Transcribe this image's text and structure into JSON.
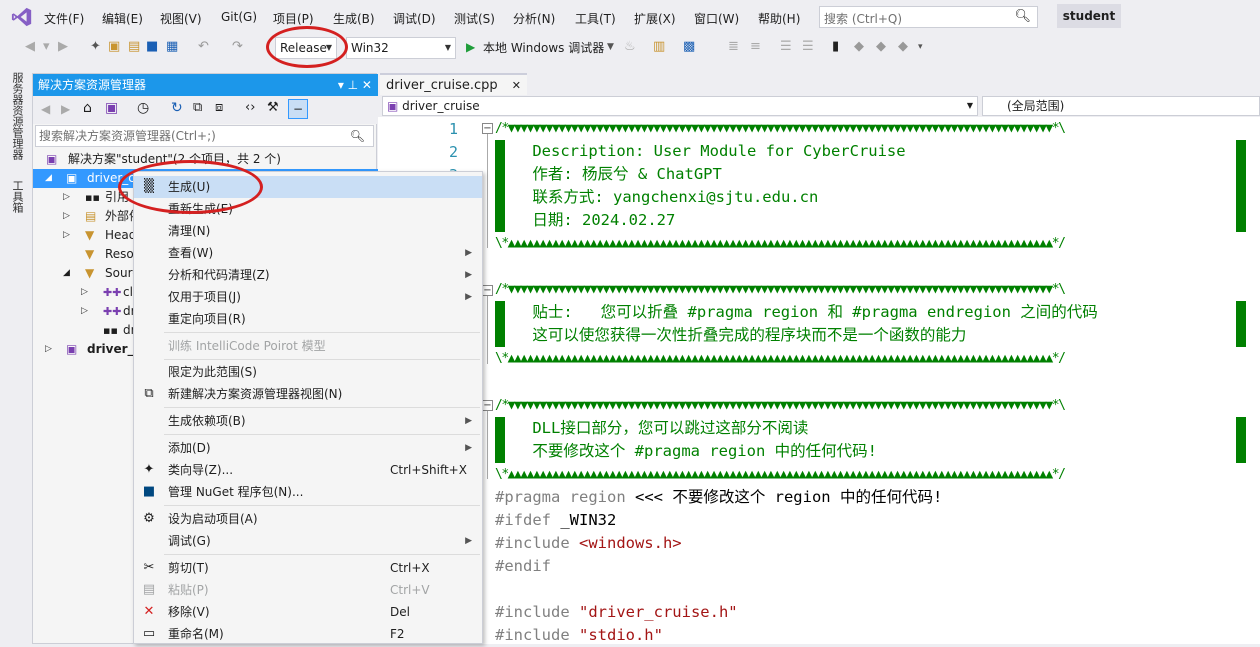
{
  "menubar": {
    "items": [
      "文件(F)",
      "编辑(E)",
      "视图(V)",
      "Git(G)",
      "项目(P)",
      "生成(B)",
      "调试(D)",
      "测试(S)",
      "分析(N)",
      "工具(T)",
      "扩展(X)",
      "窗口(W)",
      "帮助(H)"
    ],
    "search_placeholder": "搜索 (Ctrl+Q)",
    "profile": "student"
  },
  "toolbar": {
    "config": "Release",
    "platform": "Win32",
    "run_label": "本地 Windows 调试器"
  },
  "sidestrip": {
    "server_explorer": "服务器资源管理器",
    "toolbox": "工具箱"
  },
  "solution_explorer": {
    "title": "解决方案资源管理器",
    "title_controls": "▾ ⊥ ✕",
    "search_placeholder": "搜索解决方案资源管理器(Ctrl+;)",
    "tree": [
      "解决方案\"student\"(2 个项目，共 2 个)",
      "driver_c",
      "引用",
      "外部依",
      "Head",
      "Reso",
      "Sourc",
      "cla",
      "dr",
      "dr",
      "driver_c"
    ]
  },
  "editor": {
    "tab": "driver_cruise.cpp",
    "nav_left": "driver_cruise",
    "nav_right": "(全局范围)",
    "line_numbers": [
      "1",
      "2",
      "3"
    ],
    "lines": {
      "l1": "/*▼▼▼▼▼▼▼▼▼▼▼▼▼▼▼▼▼▼▼▼▼▼▼▼▼▼▼▼▼▼▼▼▼▼▼▼▼▼▼▼▼▼▼▼▼▼▼▼▼▼▼▼▼▼▼▼▼▼▼▼▼▼▼▼▼▼▼▼▼▼▼▼▼▼▼▼▼▼▼▼▼▼▼▼▼▼*\\",
      "l2": "    Description: User Module for CyberCruise",
      "l3": "    作者: 杨辰兮 & ChatGPT",
      "l4": "    联系方式: yangchenxi@sjtu.edu.cn",
      "l5": "    日期: 2024.02.27",
      "l6": "\\*▲▲▲▲▲▲▲▲▲▲▲▲▲▲▲▲▲▲▲▲▲▲▲▲▲▲▲▲▲▲▲▲▲▲▲▲▲▲▲▲▲▲▲▲▲▲▲▲▲▲▲▲▲▲▲▲▲▲▲▲▲▲▲▲▲▲▲▲▲▲▲▲▲▲▲▲▲▲▲▲▲▲▲▲▲▲*/",
      "l8": "/*▼▼▼▼▼▼▼▼▼▼▼▼▼▼▼▼▼▼▼▼▼▼▼▼▼▼▼▼▼▼▼▼▼▼▼▼▼▼▼▼▼▼▼▼▼▼▼▼▼▼▼▼▼▼▼▼▼▼▼▼▼▼▼▼▼▼▼▼▼▼▼▼▼▼▼▼▼▼▼▼▼▼▼▼▼▼*\\",
      "l9": "    贴士:   您可以折叠 #pragma region 和 #pragma endregion 之间的代码",
      "l10": "    这可以使您获得一次性折叠完成的程序块而不是一个函数的能力",
      "l11": "\\*▲▲▲▲▲▲▲▲▲▲▲▲▲▲▲▲▲▲▲▲▲▲▲▲▲▲▲▲▲▲▲▲▲▲▲▲▲▲▲▲▲▲▲▲▲▲▲▲▲▲▲▲▲▲▲▲▲▲▲▲▲▲▲▲▲▲▲▲▲▲▲▲▲▲▲▲▲▲▲▲▲▲▲▲▲▲*/",
      "l13": "/*▼▼▼▼▼▼▼▼▼▼▼▼▼▼▼▼▼▼▼▼▼▼▼▼▼▼▼▼▼▼▼▼▼▼▼▼▼▼▼▼▼▼▼▼▼▼▼▼▼▼▼▼▼▼▼▼▼▼▼▼▼▼▼▼▼▼▼▼▼▼▼▼▼▼▼▼▼▼▼▼▼▼▼▼▼▼*\\",
      "l14": "    DLL接口部分，您可以跳过这部分不阅读",
      "l15": "    不要修改这个 #pragma region 中的任何代码!",
      "l16": "\\*▲▲▲▲▲▲▲▲▲▲▲▲▲▲▲▲▲▲▲▲▲▲▲▲▲▲▲▲▲▲▲▲▲▲▲▲▲▲▲▲▲▲▲▲▲▲▲▲▲▲▲▲▲▲▲▲▲▲▲▲▲▲▲▲▲▲▲▲▲▲▲▲▲▲▲▲▲▲▲▲▲▲▲▲▲▲*/",
      "l17a": "#pragma region",
      "l17b": " <<< 不要修改这个 region 中的任何代码!",
      "l18a": "#ifdef",
      "l18b": " _WIN32",
      "l19a": "#include",
      "l19b": " <windows.h>",
      "l20": "#endif",
      "l22a": "#include",
      "l22b": " \"driver_cruise.h\"",
      "l23a": "#include",
      "l23b": " \"stdio.h\""
    }
  },
  "context_menu": {
    "items": [
      {
        "label": "生成(U)",
        "shortcut": ""
      },
      {
        "label": "重新生成(E)",
        "shortcut": ""
      },
      {
        "label": "清理(N)",
        "shortcut": ""
      },
      {
        "label": "查看(W)",
        "shortcut": ""
      },
      {
        "label": "分析和代码清理(Z)",
        "shortcut": ""
      },
      {
        "label": "仅用于项目(J)",
        "shortcut": ""
      },
      {
        "label": "重定向项目(R)",
        "shortcut": ""
      },
      {
        "label": "训练 IntelliCode Poirot 模型",
        "shortcut": ""
      },
      {
        "label": "限定为此范围(S)",
        "shortcut": ""
      },
      {
        "label": "新建解决方案资源管理器视图(N)",
        "shortcut": ""
      },
      {
        "label": "生成依赖项(B)",
        "shortcut": ""
      },
      {
        "label": "添加(D)",
        "shortcut": ""
      },
      {
        "label": "类向导(Z)...",
        "shortcut": "Ctrl+Shift+X"
      },
      {
        "label": "管理 NuGet 程序包(N)...",
        "shortcut": ""
      },
      {
        "label": "设为启动项目(A)",
        "shortcut": ""
      },
      {
        "label": "调试(G)",
        "shortcut": ""
      },
      {
        "label": "剪切(T)",
        "shortcut": "Ctrl+X"
      },
      {
        "label": "粘贴(P)",
        "shortcut": "Ctrl+V"
      },
      {
        "label": "移除(V)",
        "shortcut": "Del"
      },
      {
        "label": "重命名(M)",
        "shortcut": "F2"
      }
    ]
  },
  "colors": {
    "accent": "#1c97ea",
    "highlight": "#3399ff",
    "annotation": "#d42020",
    "comment": "#008000"
  }
}
